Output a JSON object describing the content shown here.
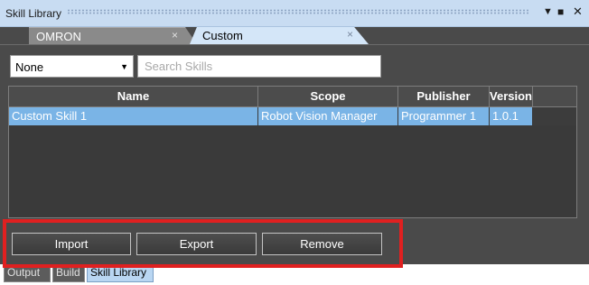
{
  "window": {
    "title": "Skill Library",
    "controls": {
      "dropdown_icon": "chevron-down-icon",
      "maximize_icon": "maximize-icon",
      "close_icon": "close-icon"
    }
  },
  "tabs": [
    {
      "label": "OMRON",
      "close": "×",
      "active": false
    },
    {
      "label": "Custom",
      "close": "×",
      "active": true
    }
  ],
  "filter": {
    "selected": "None"
  },
  "search": {
    "placeholder": "Search Skills",
    "value": ""
  },
  "table": {
    "columns": [
      "Name",
      "Scope",
      "Publisher",
      "Version"
    ],
    "rows": [
      {
        "name": "Custom Skill 1",
        "scope": "Robot Vision Manager",
        "publisher": "Programmer 1",
        "version": "1.0.1"
      }
    ]
  },
  "buttons": {
    "import": "Import",
    "export": "Export",
    "remove": "Remove"
  },
  "bottom_tabs": [
    "Output",
    "Build",
    "Skill Library"
  ],
  "colors": {
    "highlight": "#e02020",
    "selection": "#7ab4e6",
    "title_bar": "#c8dcf2"
  }
}
